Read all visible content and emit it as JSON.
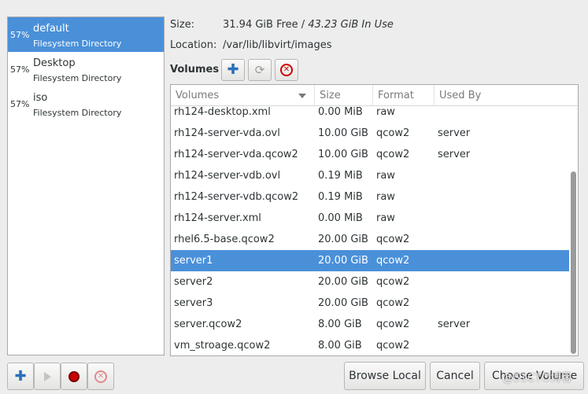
{
  "pools": [
    {
      "percent": "57%",
      "name": "default",
      "type": "Filesystem Directory",
      "selected": true
    },
    {
      "percent": "57%",
      "name": "Desktop",
      "type": "Filesystem Directory",
      "selected": false
    },
    {
      "percent": "57%",
      "name": "iso",
      "type": "Filesystem Directory",
      "selected": false
    }
  ],
  "details": {
    "size_label": "Size:",
    "size_free": "31.94 GiB Free / ",
    "size_in_use": "43.23 GiB In Use",
    "location_label": "Location:",
    "location_value": "/var/lib/libvirt/images",
    "volumes_label": "Volumes"
  },
  "volume_toolbar": {
    "add_icon": "plus-icon",
    "refresh_icon": "refresh-icon",
    "delete_icon": "stop-icon"
  },
  "table": {
    "headers": [
      "Volumes",
      "Size",
      "Format",
      "Used By"
    ],
    "rows": [
      {
        "name": "rh124-desktop.xml",
        "size": "0.00 MiB",
        "format": "raw",
        "used_by": ""
      },
      {
        "name": "rh124-server-vda.ovl",
        "size": "10.00 GiB",
        "format": "qcow2",
        "used_by": "server"
      },
      {
        "name": "rh124-server-vda.qcow2",
        "size": "10.00 GiB",
        "format": "qcow2",
        "used_by": "server"
      },
      {
        "name": "rh124-server-vdb.ovl",
        "size": "0.19 MiB",
        "format": "raw",
        "used_by": ""
      },
      {
        "name": "rh124-server-vdb.qcow2",
        "size": "0.19 MiB",
        "format": "raw",
        "used_by": ""
      },
      {
        "name": "rh124-server.xml",
        "size": "0.00 MiB",
        "format": "raw",
        "used_by": ""
      },
      {
        "name": "rhel6.5-base.qcow2",
        "size": "20.00 GiB",
        "format": "qcow2",
        "used_by": ""
      },
      {
        "name": "server1",
        "size": "20.00 GiB",
        "format": "qcow2",
        "used_by": "",
        "selected": true
      },
      {
        "name": "server2",
        "size": "20.00 GiB",
        "format": "qcow2",
        "used_by": ""
      },
      {
        "name": "server3",
        "size": "20.00 GiB",
        "format": "qcow2",
        "used_by": ""
      },
      {
        "name": "server.qcow2",
        "size": "8.00 GiB",
        "format": "qcow2",
        "used_by": "server"
      },
      {
        "name": "vm_stroage.qcow2",
        "size": "8.00 GiB",
        "format": "qcow2",
        "used_by": ""
      }
    ]
  },
  "bottom_buttons": {
    "browse_local": "Browse Local",
    "cancel": "Cancel",
    "choose_volume": "Choose Volume"
  },
  "watermark": "@51CTO博客",
  "colors": {
    "selection": "#4a90d9",
    "stop_red": "#cc0000",
    "add_blue": "#2a6fb8"
  }
}
